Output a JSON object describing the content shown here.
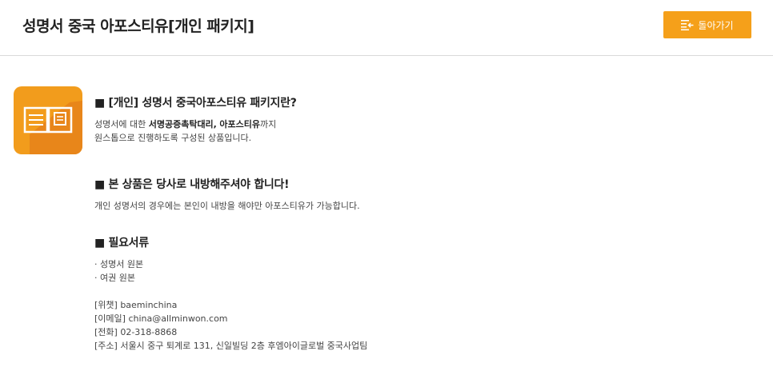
{
  "header": {
    "title": "성명서 중국 아포스티유[개인 패키지]",
    "back_label": "돌아가기",
    "back_icon": "list-back-icon",
    "accent_color": "#f5a01a"
  },
  "logo": {
    "icon": "open-book-icon",
    "color": "#f29c1c"
  },
  "sections": {
    "intro": {
      "title": "■ [개인] 성명서 중국아포스티유 패키지란?",
      "line1_pre": "성명서에 대한 ",
      "line1_bold1": "서명공증촉탁대리,",
      "line1_mid": " ",
      "line1_bold2": "아포스티유",
      "line1_post": "까지",
      "line2": "원스톱으로 진행하도록 구성된 상품입니다."
    },
    "shipping": {
      "title": "■ 본 상품은 당사로 내방해주셔야 합니다!",
      "line1": "개인 성명서의 경우에는 본인이 내방을 해야만 아포스티유가 가능합니다."
    },
    "documents": {
      "title": "■ 필요서류",
      "items": [
        "· 성명서 원본",
        "· 여권 원본"
      ]
    },
    "contact": {
      "wechat": "[위챗] baeminchina",
      "email": "[이메일] china@allminwon.com",
      "phone": "[전화] 02-318-8868",
      "address": "[주소] 서울시 중구 퇴계로 131, 신일빌딩 2층 후엠아이글로벌 중국사업팀"
    }
  }
}
